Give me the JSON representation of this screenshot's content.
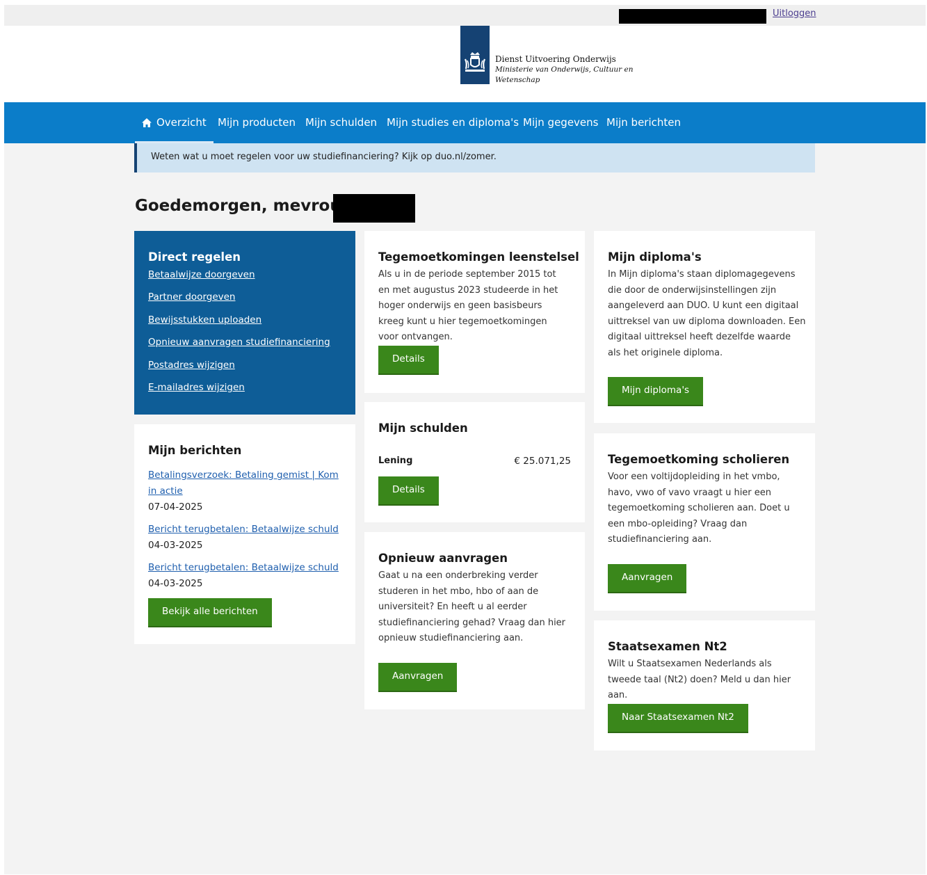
{
  "header": {
    "logout_label": "Uitloggen",
    "org_name": "Dienst Uitvoering Onderwijs",
    "ministry_line1": "Ministerie van Onderwijs, Cultuur en",
    "ministry_line2": "Wetenschap"
  },
  "nav": {
    "items": [
      {
        "label": "Overzicht",
        "active": true,
        "icon": "home-icon"
      },
      {
        "label": "Mijn producten"
      },
      {
        "label": "Mijn schulden"
      },
      {
        "label": "Mijn studies en diploma's"
      },
      {
        "label": "Mijn gegevens"
      },
      {
        "label": "Mijn berichten"
      }
    ]
  },
  "notice": {
    "text": "Weten wat u moet regelen voor uw studiefinanciering? Kijk op duo.nl/zomer."
  },
  "greeting": "Goedemorgen, mevrouw",
  "direct": {
    "title": "Direct regelen",
    "links": [
      "Betaalwijze doorgeven",
      "Partner doorgeven",
      "Bewijsstukken uploaden",
      "Opnieuw aanvragen studiefinanciering",
      "Postadres wijzigen",
      "E-mailadres wijzigen"
    ]
  },
  "messages": {
    "title": "Mijn berichten",
    "items": [
      {
        "subject": "Betalingsverzoek: Betaling gemist | Kom in actie",
        "date": "07-04-2025"
      },
      {
        "subject": "Bericht terugbetalen: Betaalwijze schuld",
        "date": "04-03-2025"
      },
      {
        "subject": "Bericht terugbetalen: Betaalwijze schuld",
        "date": "04-03-2025"
      }
    ],
    "button": "Bekijk alle berichten"
  },
  "leenstelsel": {
    "title": "Tegemoetkomingen leenstelsel",
    "text": "Als u in de periode september 2015 tot en met augustus 2023 studeerde in het hoger onderwijs en geen basisbeurs kreeg kunt u hier tegemoetkomingen voor ontvangen.",
    "button": "Details"
  },
  "schulden": {
    "title": "Mijn schulden",
    "loan_label": "Lening",
    "loan_value": "€ 25.071,25",
    "button": "Details"
  },
  "opnieuw": {
    "title": "Opnieuw aanvragen",
    "text": "Gaat u na een onderbreking verder studeren in het mbo, hbo of aan de universiteit? En heeft u al eerder studiefinanciering gehad? Vraag dan hier opnieuw studiefinanciering aan.",
    "button": "Aanvragen"
  },
  "diplomas": {
    "title": "Mijn diploma's",
    "text": "In Mijn diploma's staan diplomagegevens die door de onderwijsinstellingen zijn aangeleverd aan DUO. U kunt een digitaal uittreksel van uw diploma downloaden. Een digitaal uittreksel heeft dezelfde waarde als het originele diploma.",
    "button": "Mijn diploma's"
  },
  "scholieren": {
    "title": "Tegemoetkoming scholieren",
    "text": "Voor een voltijdopleiding in het vmbo, havo, vwo of vavo vraagt u hier een tegemoetkoming scholieren aan. Doet u een mbo-opleiding? Vraag dan studiefinanciering aan.",
    "button": "Aanvragen"
  },
  "nt2": {
    "title": "Staatsexamen Nt2",
    "text": "Wilt u Staatsexamen Nederlands als tweede taal (Nt2) doen? Meld u dan hier aan.",
    "button": "Naar Staatsexamen Nt2"
  },
  "colors": {
    "nav_blue": "#0b7dc9",
    "panel_blue": "#0e5d97",
    "logo_blue": "#154273",
    "button_green": "#3a871b",
    "notice_bg": "#cfe3f2"
  }
}
